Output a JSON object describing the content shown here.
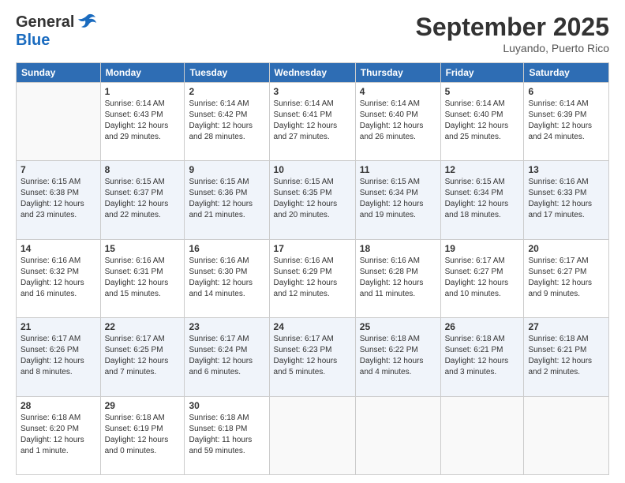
{
  "header": {
    "logo_general": "General",
    "logo_blue": "Blue",
    "month_title": "September 2025",
    "location": "Luyando, Puerto Rico"
  },
  "days_of_week": [
    "Sunday",
    "Monday",
    "Tuesday",
    "Wednesday",
    "Thursday",
    "Friday",
    "Saturday"
  ],
  "weeks": [
    [
      {
        "day": "",
        "sunrise": "",
        "sunset": "",
        "daylight": ""
      },
      {
        "day": "1",
        "sunrise": "Sunrise: 6:14 AM",
        "sunset": "Sunset: 6:43 PM",
        "daylight": "Daylight: 12 hours and 29 minutes."
      },
      {
        "day": "2",
        "sunrise": "Sunrise: 6:14 AM",
        "sunset": "Sunset: 6:42 PM",
        "daylight": "Daylight: 12 hours and 28 minutes."
      },
      {
        "day": "3",
        "sunrise": "Sunrise: 6:14 AM",
        "sunset": "Sunset: 6:41 PM",
        "daylight": "Daylight: 12 hours and 27 minutes."
      },
      {
        "day": "4",
        "sunrise": "Sunrise: 6:14 AM",
        "sunset": "Sunset: 6:40 PM",
        "daylight": "Daylight: 12 hours and 26 minutes."
      },
      {
        "day": "5",
        "sunrise": "Sunrise: 6:14 AM",
        "sunset": "Sunset: 6:40 PM",
        "daylight": "Daylight: 12 hours and 25 minutes."
      },
      {
        "day": "6",
        "sunrise": "Sunrise: 6:14 AM",
        "sunset": "Sunset: 6:39 PM",
        "daylight": "Daylight: 12 hours and 24 minutes."
      }
    ],
    [
      {
        "day": "7",
        "sunrise": "Sunrise: 6:15 AM",
        "sunset": "Sunset: 6:38 PM",
        "daylight": "Daylight: 12 hours and 23 minutes."
      },
      {
        "day": "8",
        "sunrise": "Sunrise: 6:15 AM",
        "sunset": "Sunset: 6:37 PM",
        "daylight": "Daylight: 12 hours and 22 minutes."
      },
      {
        "day": "9",
        "sunrise": "Sunrise: 6:15 AM",
        "sunset": "Sunset: 6:36 PM",
        "daylight": "Daylight: 12 hours and 21 minutes."
      },
      {
        "day": "10",
        "sunrise": "Sunrise: 6:15 AM",
        "sunset": "Sunset: 6:35 PM",
        "daylight": "Daylight: 12 hours and 20 minutes."
      },
      {
        "day": "11",
        "sunrise": "Sunrise: 6:15 AM",
        "sunset": "Sunset: 6:34 PM",
        "daylight": "Daylight: 12 hours and 19 minutes."
      },
      {
        "day": "12",
        "sunrise": "Sunrise: 6:15 AM",
        "sunset": "Sunset: 6:34 PM",
        "daylight": "Daylight: 12 hours and 18 minutes."
      },
      {
        "day": "13",
        "sunrise": "Sunrise: 6:16 AM",
        "sunset": "Sunset: 6:33 PM",
        "daylight": "Daylight: 12 hours and 17 minutes."
      }
    ],
    [
      {
        "day": "14",
        "sunrise": "Sunrise: 6:16 AM",
        "sunset": "Sunset: 6:32 PM",
        "daylight": "Daylight: 12 hours and 16 minutes."
      },
      {
        "day": "15",
        "sunrise": "Sunrise: 6:16 AM",
        "sunset": "Sunset: 6:31 PM",
        "daylight": "Daylight: 12 hours and 15 minutes."
      },
      {
        "day": "16",
        "sunrise": "Sunrise: 6:16 AM",
        "sunset": "Sunset: 6:30 PM",
        "daylight": "Daylight: 12 hours and 14 minutes."
      },
      {
        "day": "17",
        "sunrise": "Sunrise: 6:16 AM",
        "sunset": "Sunset: 6:29 PM",
        "daylight": "Daylight: 12 hours and 12 minutes."
      },
      {
        "day": "18",
        "sunrise": "Sunrise: 6:16 AM",
        "sunset": "Sunset: 6:28 PM",
        "daylight": "Daylight: 12 hours and 11 minutes."
      },
      {
        "day": "19",
        "sunrise": "Sunrise: 6:17 AM",
        "sunset": "Sunset: 6:27 PM",
        "daylight": "Daylight: 12 hours and 10 minutes."
      },
      {
        "day": "20",
        "sunrise": "Sunrise: 6:17 AM",
        "sunset": "Sunset: 6:27 PM",
        "daylight": "Daylight: 12 hours and 9 minutes."
      }
    ],
    [
      {
        "day": "21",
        "sunrise": "Sunrise: 6:17 AM",
        "sunset": "Sunset: 6:26 PM",
        "daylight": "Daylight: 12 hours and 8 minutes."
      },
      {
        "day": "22",
        "sunrise": "Sunrise: 6:17 AM",
        "sunset": "Sunset: 6:25 PM",
        "daylight": "Daylight: 12 hours and 7 minutes."
      },
      {
        "day": "23",
        "sunrise": "Sunrise: 6:17 AM",
        "sunset": "Sunset: 6:24 PM",
        "daylight": "Daylight: 12 hours and 6 minutes."
      },
      {
        "day": "24",
        "sunrise": "Sunrise: 6:17 AM",
        "sunset": "Sunset: 6:23 PM",
        "daylight": "Daylight: 12 hours and 5 minutes."
      },
      {
        "day": "25",
        "sunrise": "Sunrise: 6:18 AM",
        "sunset": "Sunset: 6:22 PM",
        "daylight": "Daylight: 12 hours and 4 minutes."
      },
      {
        "day": "26",
        "sunrise": "Sunrise: 6:18 AM",
        "sunset": "Sunset: 6:21 PM",
        "daylight": "Daylight: 12 hours and 3 minutes."
      },
      {
        "day": "27",
        "sunrise": "Sunrise: 6:18 AM",
        "sunset": "Sunset: 6:21 PM",
        "daylight": "Daylight: 12 hours and 2 minutes."
      }
    ],
    [
      {
        "day": "28",
        "sunrise": "Sunrise: 6:18 AM",
        "sunset": "Sunset: 6:20 PM",
        "daylight": "Daylight: 12 hours and 1 minute."
      },
      {
        "day": "29",
        "sunrise": "Sunrise: 6:18 AM",
        "sunset": "Sunset: 6:19 PM",
        "daylight": "Daylight: 12 hours and 0 minutes."
      },
      {
        "day": "30",
        "sunrise": "Sunrise: 6:18 AM",
        "sunset": "Sunset: 6:18 PM",
        "daylight": "Daylight: 11 hours and 59 minutes."
      },
      {
        "day": "",
        "sunrise": "",
        "sunset": "",
        "daylight": ""
      },
      {
        "day": "",
        "sunrise": "",
        "sunset": "",
        "daylight": ""
      },
      {
        "day": "",
        "sunrise": "",
        "sunset": "",
        "daylight": ""
      },
      {
        "day": "",
        "sunrise": "",
        "sunset": "",
        "daylight": ""
      }
    ]
  ]
}
